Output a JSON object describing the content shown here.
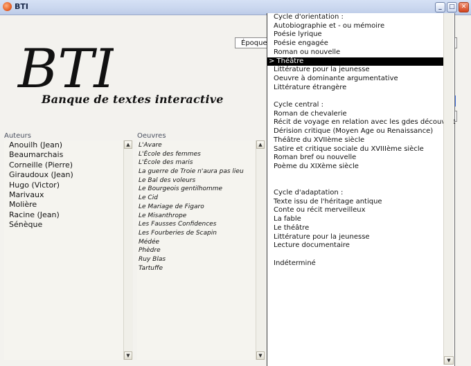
{
  "window": {
    "title": "BTI",
    "minimize": "_",
    "maximize": "□",
    "close": "✕"
  },
  "header": {
    "logo_text": "BTI",
    "subtitle": "Banque de textes interactive"
  },
  "filter": {
    "epoque_label": "Époque"
  },
  "authors": {
    "header": "Auteurs",
    "items": [
      "Anouilh (Jean)",
      "Beaumarchais",
      "Corneille (Pierre)",
      "Giraudoux (Jean)",
      "Hugo (Victor)",
      "Marivaux",
      "Molière",
      "Racine (Jean)",
      "Sénèque"
    ]
  },
  "works": {
    "header": "Oeuvres",
    "items": [
      "L'Avare",
      "L'École des femmes",
      "L'École des maris",
      "La guerre de Troie n'aura pas lieu",
      "Le Bal des voleurs",
      "Le Bourgeois gentilhomme",
      "Le Cid",
      "Le Mariage de Figaro",
      "Le Misanthrope",
      "Les Fausses Confidences",
      "Les Fourberies de Scapin",
      "Médée",
      "Phèdre",
      "Ruy Blas",
      "Tartuffe"
    ]
  },
  "genre_dropdown": {
    "items": [
      "Cycle d'orientation :",
      "Autobiographie et - ou mémoire",
      "Poésie lyrique",
      "Poésie engagée",
      "Roman ou nouvelle",
      "> Théâtre",
      "Littérature pour la jeunesse",
      "Oeuvre à dominante argumentative",
      "Littérature étrangère",
      "",
      "Cycle central :",
      "Roman de chevalerie",
      "Récit de voyage en relation avec les gdes découvert",
      "Dérision critique (Moyen Age ou Renaissance)",
      "Théâtre du XVIIème siècle",
      "Satire et critique sociale du XVIIIème siècle",
      "Roman bref ou nouvelle",
      "Poème du XIXème siècle",
      "",
      "",
      "Cycle d'adaptation :",
      "Texte issu de l'héritage antique",
      "Conte ou récit merveilleux",
      "La fable",
      "Le théâtre",
      "Littérature pour la jeunesse",
      "Lecture documentaire",
      "",
      "Indéterminé"
    ],
    "selected_index": 5
  },
  "scroll": {
    "up": "▲",
    "down": "▼"
  },
  "colors": {
    "selection_bg": "#000000",
    "selection_fg": "#ffffff"
  }
}
